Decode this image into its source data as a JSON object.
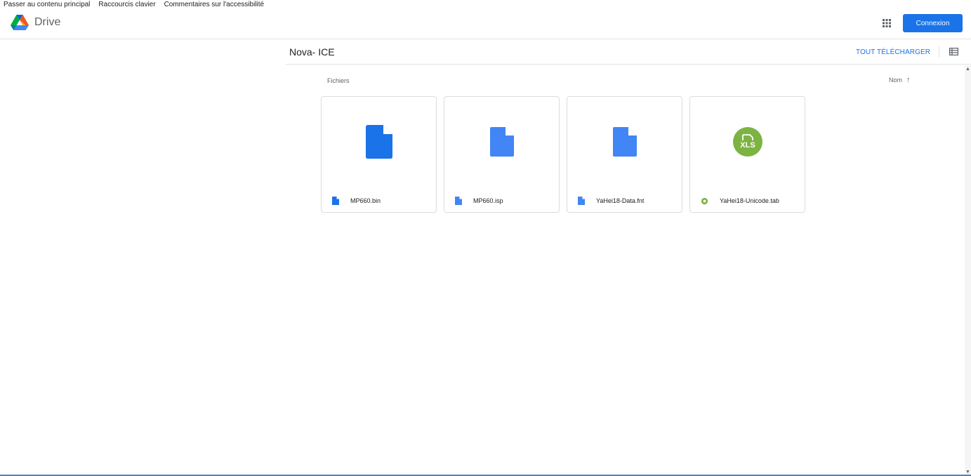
{
  "skip_links": [
    "Passer au contenu principal",
    "Raccourcis clavier",
    "Commentaires sur l'accessibilité"
  ],
  "header": {
    "logo_text": "Drive",
    "apps_icon": "apps-grid-icon",
    "connexion_label": "Connexion"
  },
  "folder": {
    "title": "Nova- ICE",
    "download_all_label": "TOUT TÉLÉCHARGER",
    "view_icon": "list-view-icon"
  },
  "files_section": {
    "label": "Fichiers",
    "sort_label": "Nom",
    "sort_direction_icon": "arrow-up-icon"
  },
  "files": [
    {
      "name": "MP660.bin",
      "icon": "doc-file-icon",
      "color": "#1a73e8"
    },
    {
      "name": "MP660.isp",
      "icon": "doc-file-icon",
      "color": "#4285f4"
    },
    {
      "name": "YaHei18-Data.fnt",
      "icon": "doc-file-icon",
      "color": "#4285f4"
    },
    {
      "name": "YaHei18-Unicode.tab",
      "icon": "xls-file-icon",
      "color": "#7cb342",
      "badge": "XLS"
    }
  ],
  "colors": {
    "accent": "#1a73e8",
    "xls_green": "#7cb342"
  }
}
